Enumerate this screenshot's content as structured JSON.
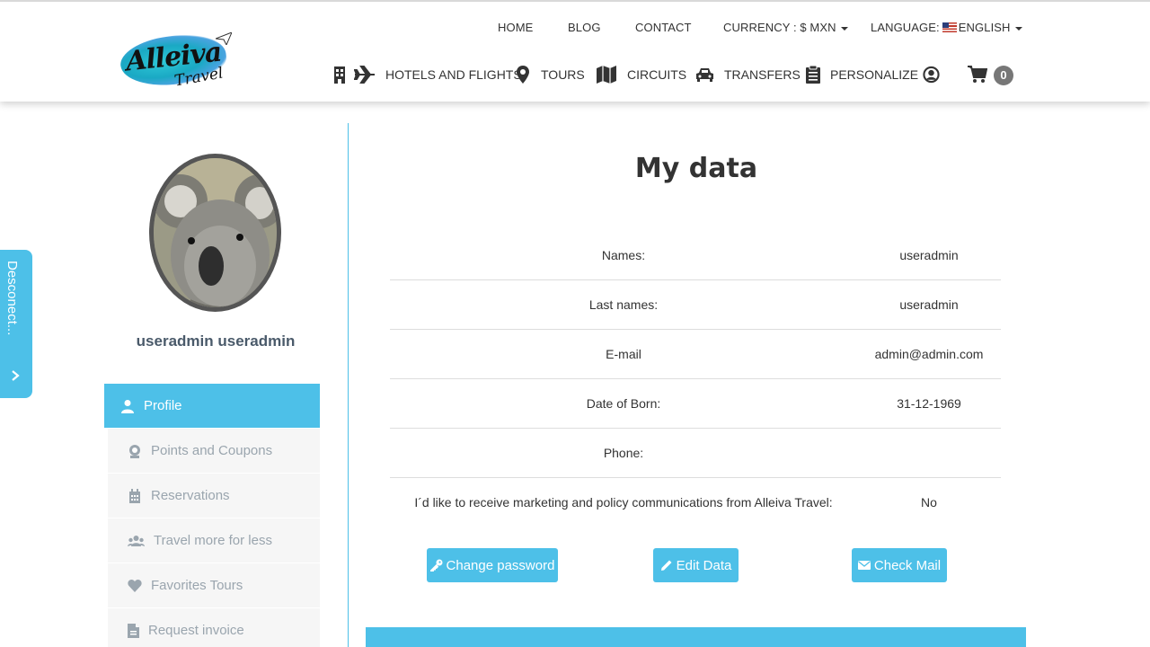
{
  "brand": {
    "name": "Alleiva",
    "sub": "Travel"
  },
  "topnav": {
    "home": "HOME",
    "blog": "BLOG",
    "contact": "CONTACT",
    "currency": "CURRENCY : $ MXN",
    "language_label": "LANGUAGE:",
    "language_value": "ENGLISH"
  },
  "mainnav": {
    "hotels_flights": "HOTELS AND FLIGHTS",
    "tours": "TOURS",
    "circuits": "CIRCUITS",
    "transfers": "TRANSFERS",
    "personalize": "PERSONALIZE",
    "cart_count": "0"
  },
  "disconnect": {
    "label": "Desconect..."
  },
  "profile": {
    "username": "useradmin useradmin"
  },
  "sidebar": {
    "items": [
      {
        "label": "Profile",
        "icon": "user-icon"
      },
      {
        "label": "Points and Coupons",
        "icon": "coupon-icon"
      },
      {
        "label": "Reservations",
        "icon": "calendar-icon"
      },
      {
        "label": "Travel more for less",
        "icon": "group-icon"
      },
      {
        "label": "Favorites Tours",
        "icon": "heart-icon"
      },
      {
        "label": "Request invoice",
        "icon": "document-icon"
      }
    ]
  },
  "main": {
    "title": "My data",
    "rows": [
      {
        "label": "Names:",
        "value": "useradmin"
      },
      {
        "label": "Last names:",
        "value": "useradmin"
      },
      {
        "label": "E-mail",
        "value": "admin@admin.com"
      },
      {
        "label": "Date of Born:",
        "value": "31-12-1969"
      },
      {
        "label": "Phone:",
        "value": ""
      },
      {
        "label": "I´d like to receive marketing and policy communications from Alleiva Travel:",
        "value": "No"
      }
    ],
    "buttons": {
      "change_password": "Change password",
      "edit_data": "Edit Data",
      "check_mail": "Check Mail"
    }
  },
  "colors": {
    "accent": "#4dc0e8",
    "sidebar_bg": "#f6f6f6",
    "sidebar_text": "#9aa5ae"
  }
}
